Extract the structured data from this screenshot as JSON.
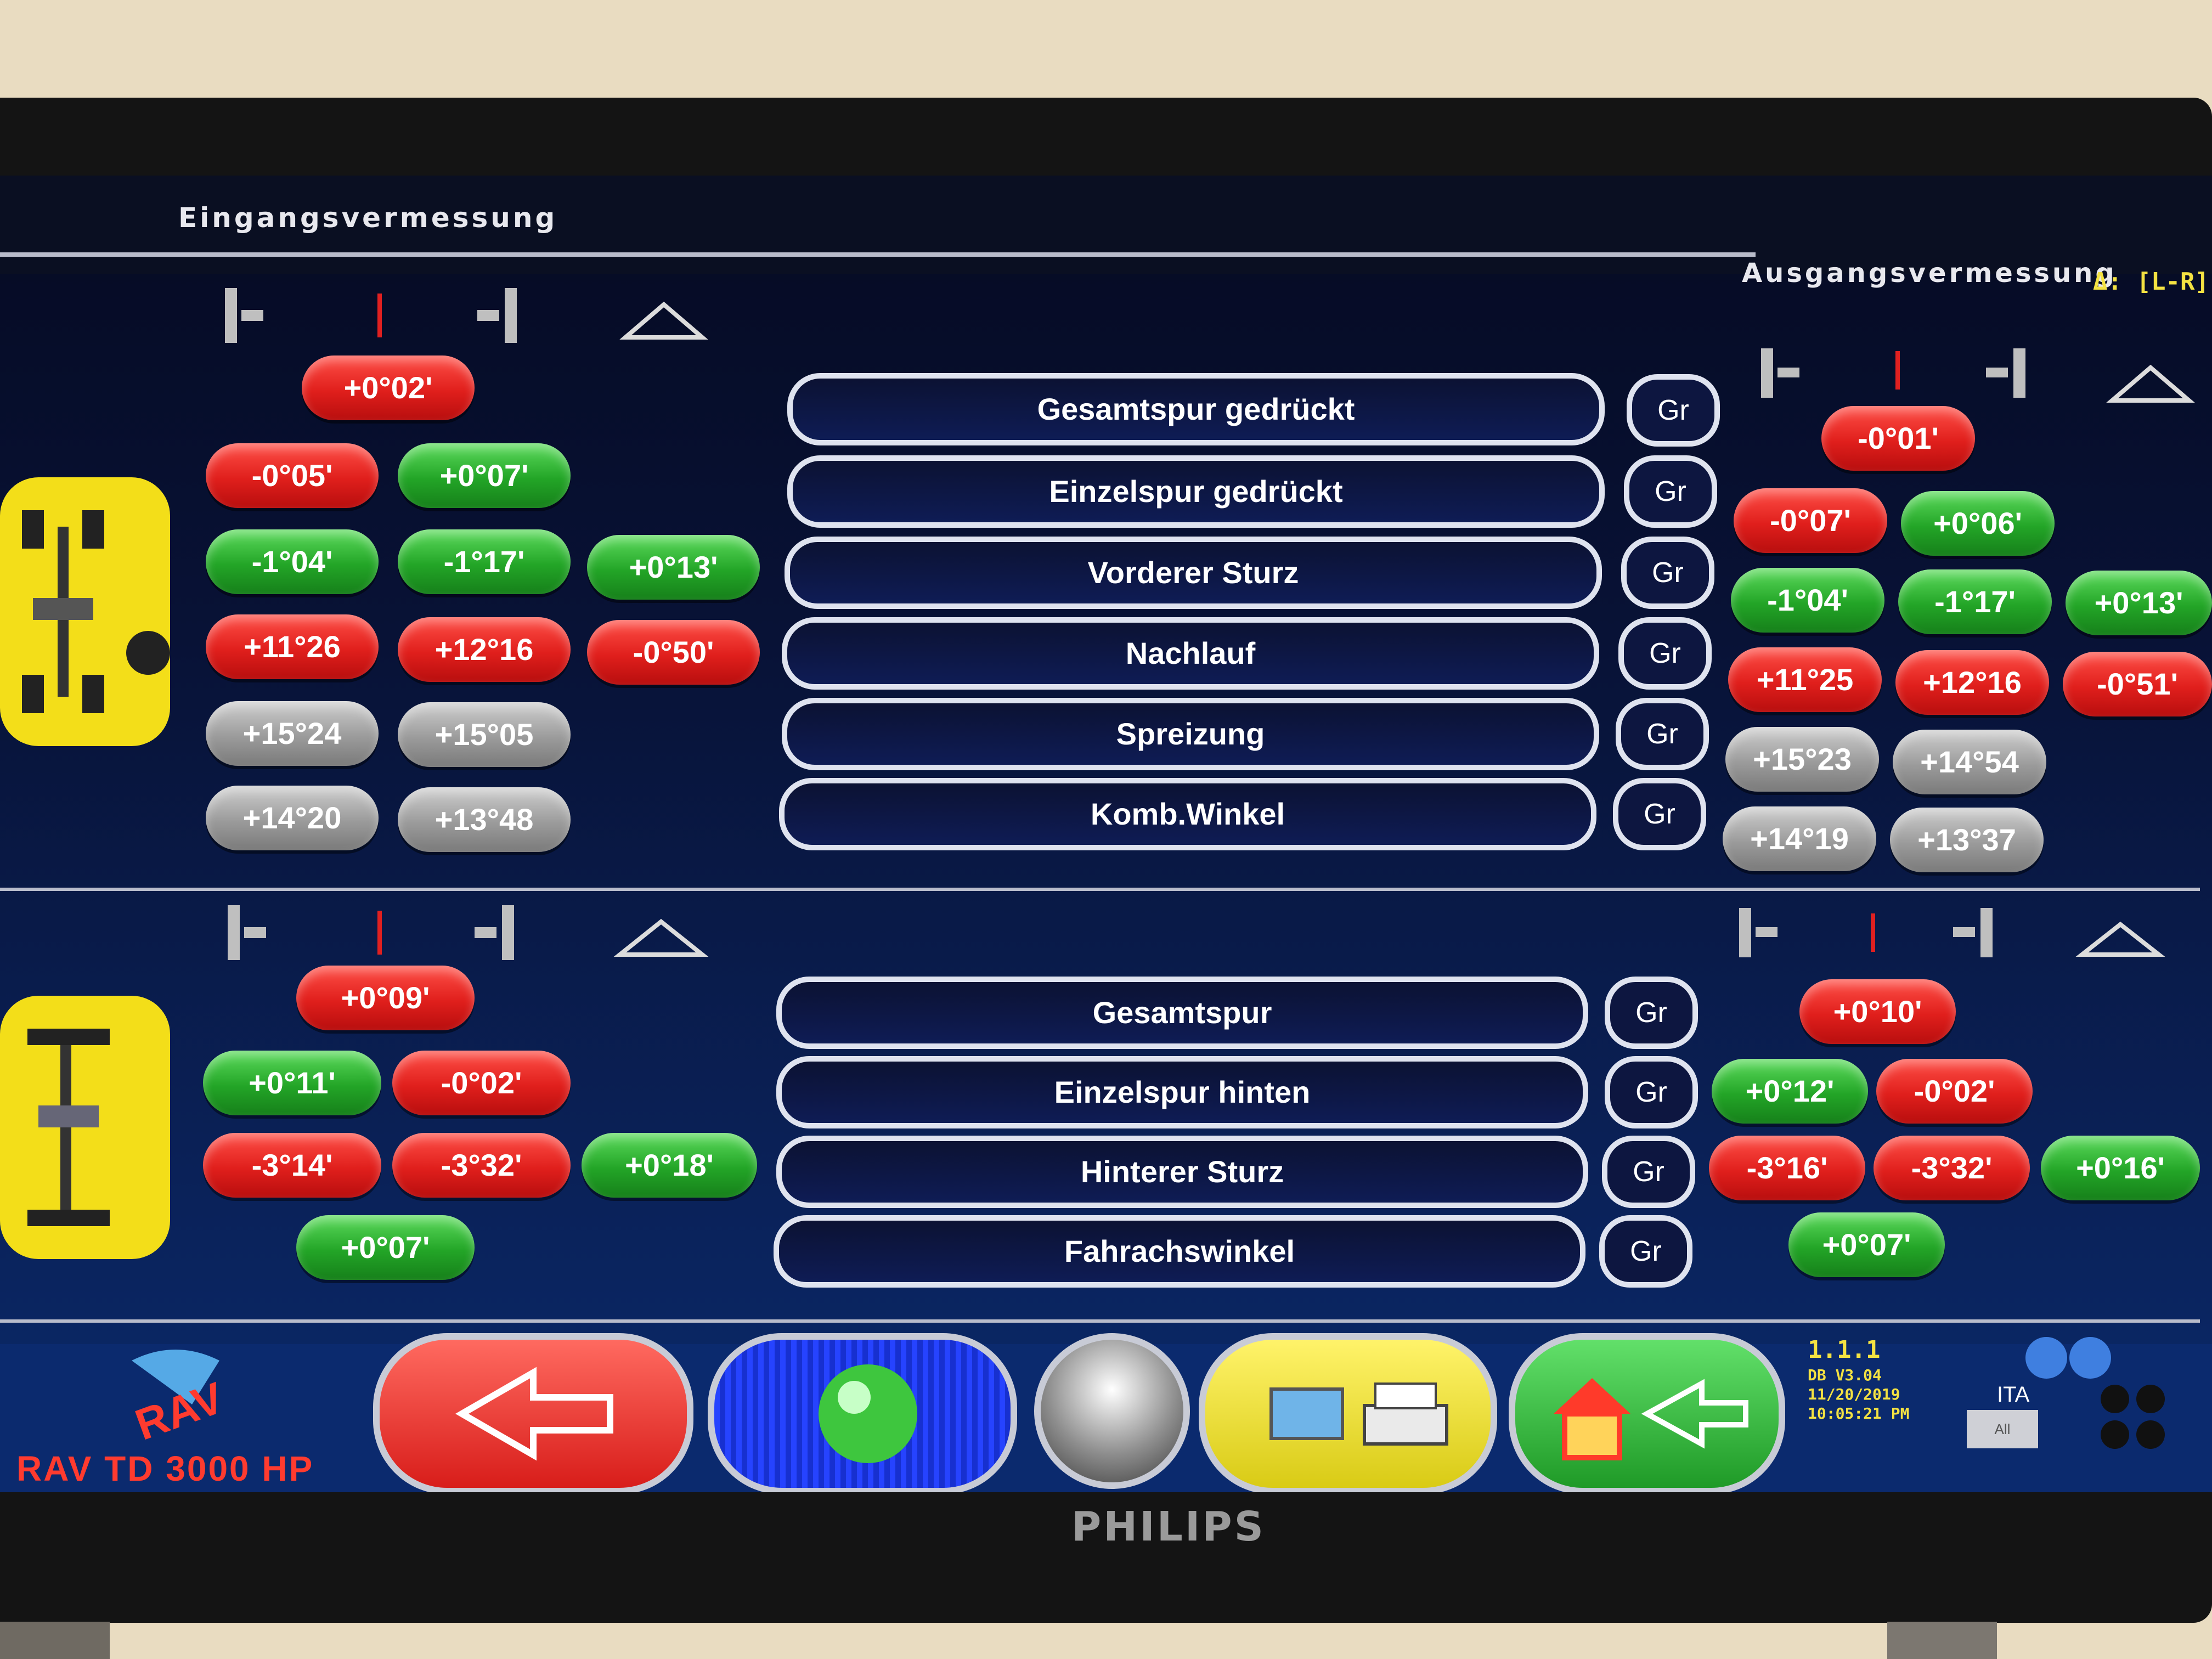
{
  "header": {
    "left_title": "Eingangsvermessung",
    "right_title": "Ausgangsvermessung",
    "delta_label": "Δ: [L-R]"
  },
  "front": {
    "rows": [
      {
        "label": "Gesamtspur gedrückt",
        "gr": "Gr"
      },
      {
        "label": "Einzelspur gedrückt",
        "gr": "Gr"
      },
      {
        "label": "Vorderer Sturz",
        "gr": "Gr"
      },
      {
        "label": "Nachlauf",
        "gr": "Gr"
      },
      {
        "label": "Spreizung",
        "gr": "Gr"
      },
      {
        "label": "Komb.Winkel",
        "gr": "Gr"
      }
    ],
    "input": {
      "total_toe": "+0°02'",
      "indiv_toe": [
        "-0°05'",
        "+0°07'"
      ],
      "camber": [
        "-1°04'",
        "-1°17'",
        "+0°13'"
      ],
      "caster": [
        "+11°26",
        "+12°16",
        "-0°50'"
      ],
      "kpi": [
        "+15°24",
        "+15°05"
      ],
      "included": [
        "+14°20",
        "+13°48"
      ]
    },
    "output": {
      "total_toe": "-0°01'",
      "indiv_toe": [
        "-0°07'",
        "+0°06'"
      ],
      "camber": [
        "-1°04'",
        "-1°17'",
        "+0°13'"
      ],
      "caster": [
        "+11°25",
        "+12°16",
        "-0°51'"
      ],
      "kpi": [
        "+15°23",
        "+14°54"
      ],
      "included": [
        "+14°19",
        "+13°37"
      ]
    }
  },
  "rear": {
    "rows": [
      {
        "label": "Gesamtspur",
        "gr": "Gr"
      },
      {
        "label": "Einzelspur hinten",
        "gr": "Gr"
      },
      {
        "label": "Hinterer Sturz",
        "gr": "Gr"
      },
      {
        "label": "Fahrachswinkel",
        "gr": "Gr"
      }
    ],
    "input": {
      "total_toe": "+0°09'",
      "indiv_toe": [
        "+0°11'",
        "-0°02'"
      ],
      "camber": [
        "-3°14'",
        "-3°32'",
        "+0°18'"
      ],
      "thrust": "+0°07'"
    },
    "output": {
      "total_toe": "+0°10'",
      "indiv_toe": [
        "+0°12'",
        "-0°02'"
      ],
      "camber": [
        "-3°16'",
        "-3°32'",
        "+0°16'"
      ],
      "thrust": "+0°07'"
    }
  },
  "footer": {
    "logo_text": "RAV",
    "model": "RAV TD 3000 HP",
    "version": "1.1.1",
    "db_version": "DB V3.04",
    "date": "11/20/2019",
    "time": "10:05:21 PM",
    "language": "ITA",
    "lang_button": "All"
  },
  "monitor_brand": "PHILIPS",
  "colors": {
    "red": "#e01f1c",
    "green": "#23a527",
    "gray": "#9b9b9b",
    "highlight": "#f4e242"
  }
}
